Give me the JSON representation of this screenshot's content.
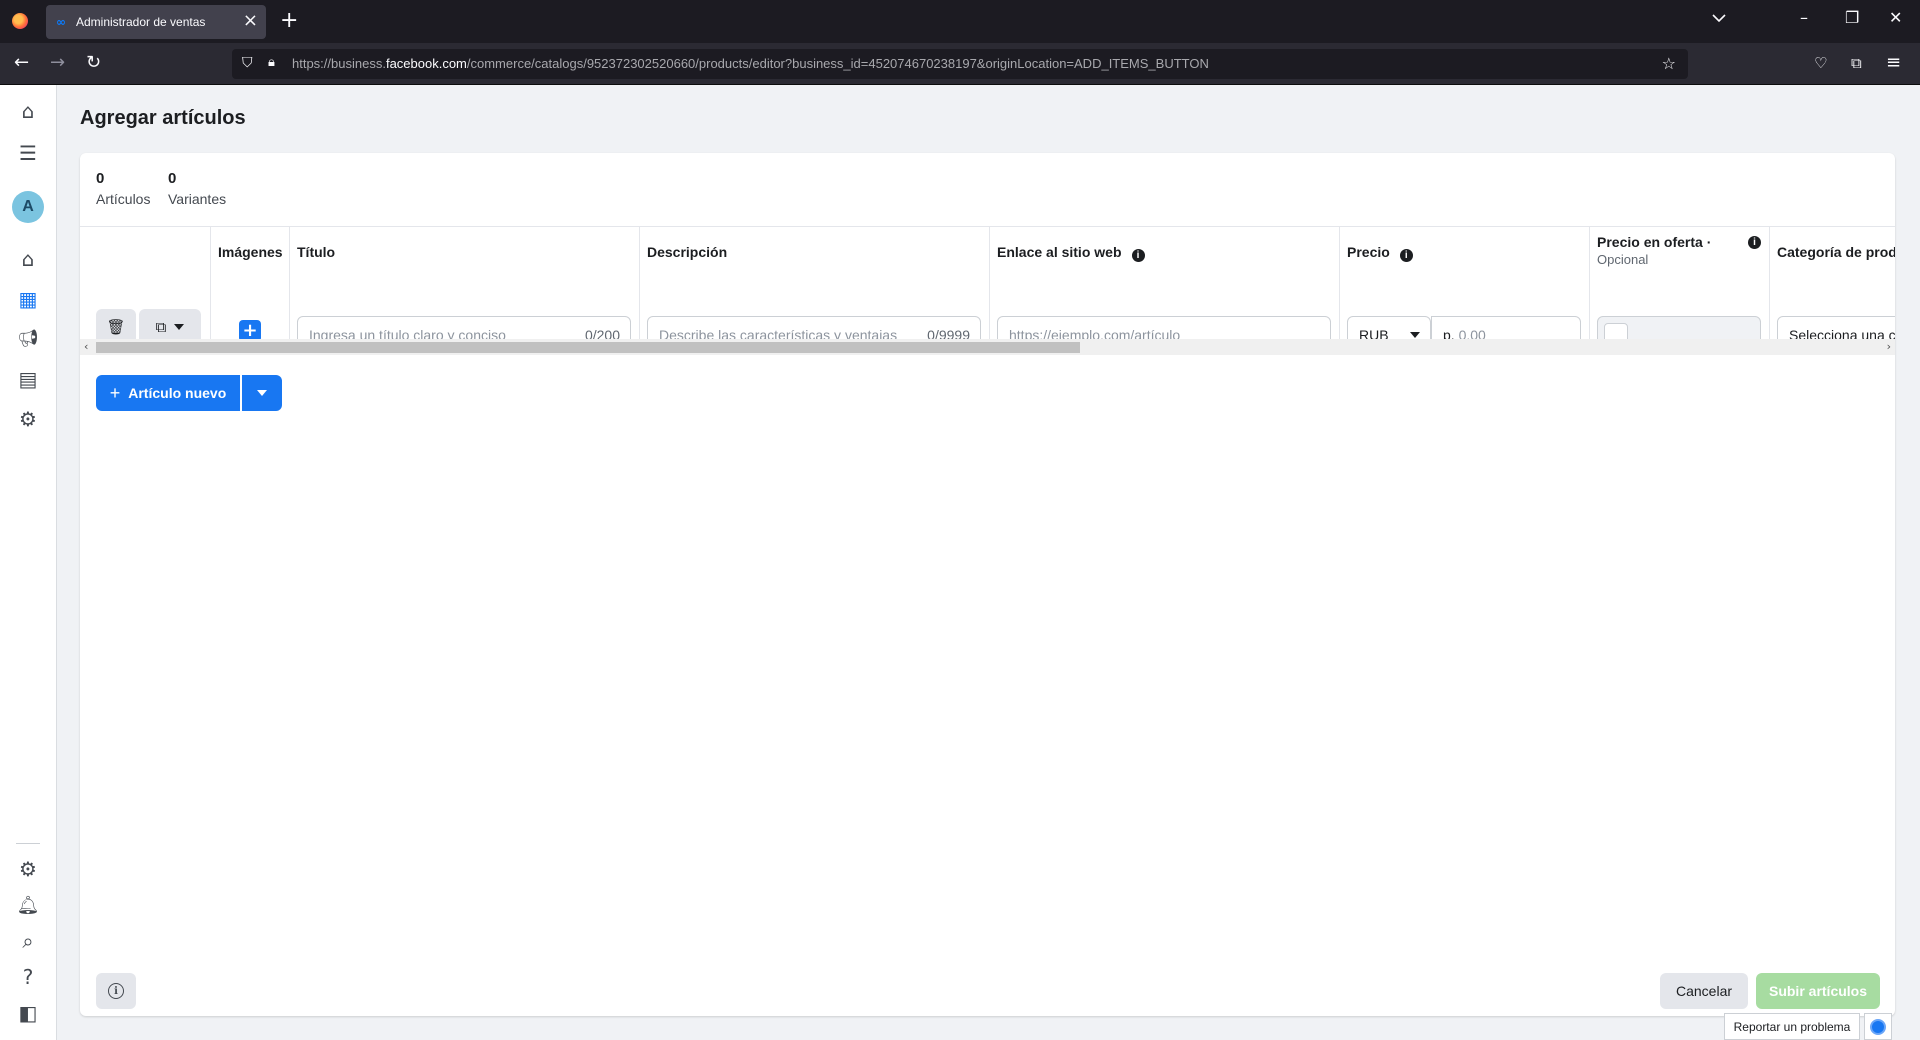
{
  "browser": {
    "tab_title": "Administrador de ventas",
    "tab_favicon": "meta-icon",
    "url_prefix": "https://business.",
    "url_host": "facebook.com",
    "url_path": "/commerce/catalogs/952372302520660/products/editor?business_id=452074670238197&originLocation=ADD_ITEMS_BUTTON"
  },
  "page": {
    "title": "Agregar artículos"
  },
  "counters": [
    {
      "value": "0",
      "label": "Artículos"
    },
    {
      "value": "0",
      "label": "Variantes"
    }
  ],
  "table": {
    "headers": {
      "images": "Imágenes",
      "title": "Título",
      "description": "Descripción",
      "website": "Enlace al sitio web",
      "price": "Precio",
      "sale_price": "Precio en oferta ·",
      "sale_price_sub": "Opcional",
      "category": "Categoría de produ"
    },
    "row": {
      "title_placeholder": "Ingresa un título claro y conciso",
      "title_count": "0/200",
      "description_placeholder": "Describe las características y ventajas",
      "description_count": "0/9999",
      "website_placeholder": "https://ejemplo.com/artículo",
      "currency": "RUB",
      "price_prefix": "р.",
      "price_placeholder": "0.00",
      "category_value": "Selecciona una c"
    }
  },
  "actions": {
    "new_item": "Artículo nuevo",
    "cancel": "Cancelar",
    "upload": "Subir artículos",
    "report": "Reportar un problema"
  },
  "colors": {
    "primary": "#1877f2",
    "upload_disabled": "#a7dca1"
  }
}
